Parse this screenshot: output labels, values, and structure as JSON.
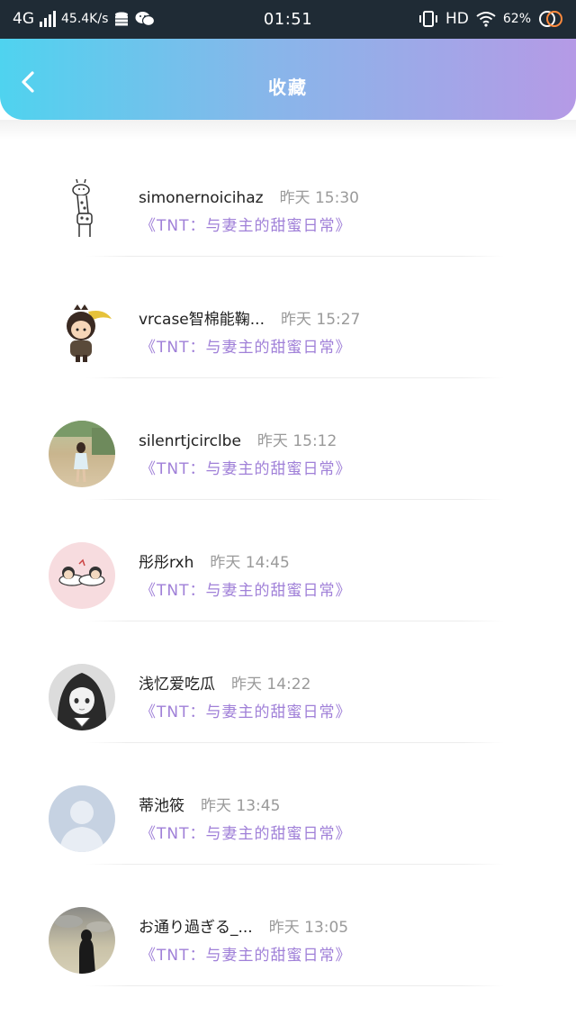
{
  "status_bar": {
    "network": "4G",
    "speed": "45.4K/s",
    "time": "01:51",
    "hd": "HD",
    "battery": "62%"
  },
  "header": {
    "title": "收藏",
    "back_icon": "chevron-left-icon"
  },
  "items": [
    {
      "username": "simonernoicihaz",
      "time": "昨天 15:30",
      "book": "《TNT：与妻主的甜蜜日常》",
      "avatar": "giraffe"
    },
    {
      "username": "vrcase智棉能鞠...",
      "time": "昨天 15:27",
      "book": "《TNT：与妻主的甜蜜日常》",
      "avatar": "chibi-ninja"
    },
    {
      "username": "silenrtjcirclbe",
      "time": "昨天 15:12",
      "book": "《TNT：与妻主的甜蜜日常》",
      "avatar": "photo-girl-field"
    },
    {
      "username": "彤彤rxh",
      "time": "昨天 14:45",
      "book": "《TNT：与妻主的甜蜜日常》",
      "avatar": "pink-cartoon"
    },
    {
      "username": "浅忆爱吃瓜",
      "time": "昨天 14:22",
      "book": "《TNT：与妻主的甜蜜日常》",
      "avatar": "anime-girl"
    },
    {
      "username": "蒂池筱",
      "time": "昨天 13:45",
      "book": "《TNT：与妻主的甜蜜日常》",
      "avatar": "default-person"
    },
    {
      "username": "お通り過ぎる_...",
      "time": "昨天 13:05",
      "book": "《TNT：与妻主的甜蜜日常》",
      "avatar": "silhouette-sky"
    }
  ]
}
